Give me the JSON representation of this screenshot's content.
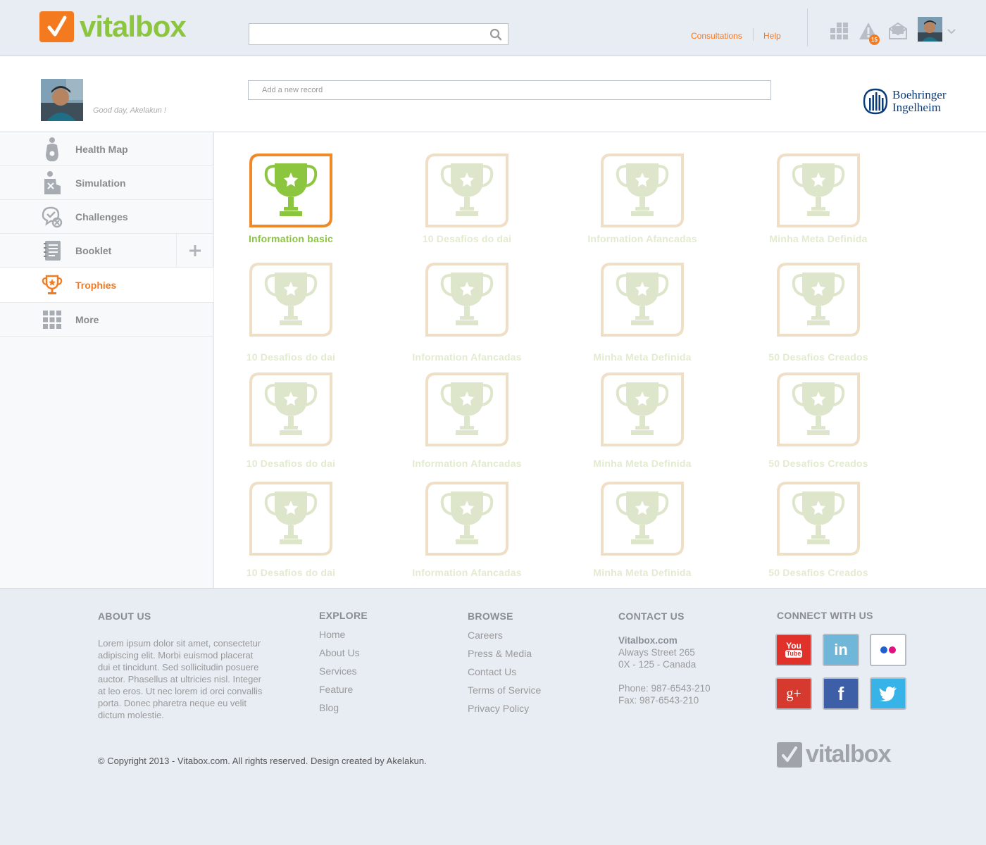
{
  "brand": {
    "name": "vitalbox",
    "accent": "#f47a20",
    "green": "#8cc63f"
  },
  "header": {
    "search_placeholder": "",
    "links": {
      "consultations": "Consultations",
      "help": "Help"
    },
    "notification_count": "15"
  },
  "profile": {
    "greeting": "Good day, Akelakun !",
    "add_record_placeholder": "Add a new record",
    "sponsor_line1": "Boehringer",
    "sponsor_line2": "Ingelheim"
  },
  "sidebar": {
    "items": [
      {
        "label": "Health Map",
        "icon": "body-map-icon"
      },
      {
        "label": "Simulation",
        "icon": "simulation-icon"
      },
      {
        "label": "Challenges",
        "icon": "challenges-icon"
      },
      {
        "label": "Booklet",
        "icon": "booklet-icon"
      },
      {
        "label": "Trophies",
        "icon": "trophy-icon",
        "active": true
      },
      {
        "label": "More",
        "icon": "grid-icon"
      }
    ]
  },
  "trophies": [
    {
      "label": "Information basic",
      "unlocked": true
    },
    {
      "label": "10 Desafios do dai",
      "unlocked": false
    },
    {
      "label": "Information Afancadas",
      "unlocked": false
    },
    {
      "label": "Minha Meta Definida",
      "unlocked": false
    },
    {
      "label": "10 Desafios do dai",
      "unlocked": false
    },
    {
      "label": "Information Afancadas",
      "unlocked": false
    },
    {
      "label": "Minha Meta Definida",
      "unlocked": false
    },
    {
      "label": "50 Desafios Creados",
      "unlocked": false
    },
    {
      "label": "10 Desafios do dai",
      "unlocked": false
    },
    {
      "label": "Information Afancadas",
      "unlocked": false
    },
    {
      "label": "Minha Meta Definida",
      "unlocked": false
    },
    {
      "label": "50 Desafios Creados",
      "unlocked": false
    },
    {
      "label": "10 Desafios do dai",
      "unlocked": false
    },
    {
      "label": "Information Afancadas",
      "unlocked": false
    },
    {
      "label": "Minha Meta Definida",
      "unlocked": false
    },
    {
      "label": "50 Desafios Creados",
      "unlocked": false
    }
  ],
  "footer": {
    "about": {
      "heading": "ABOUT US",
      "text": "Lorem ipsum dolor sit amet, consectetur adipiscing elit. Morbi euismod placerat dui et tincidunt. Sed sollicitudin posuere auctor. Phasellus at ultricies nisl. Integer at leo eros. Ut nec lorem id orci convallis porta. Donec pharetra neque eu velit dictum molestie."
    },
    "explore": {
      "heading": "EXPLORE",
      "links": [
        "Home",
        "About Us",
        "Services",
        "Feature",
        "Blog"
      ]
    },
    "browse": {
      "heading": "BROWSE",
      "links": [
        "Careers",
        "Press & Media",
        "Contact Us",
        "Terms of Service",
        "Privacy Policy"
      ]
    },
    "contact": {
      "heading": "CONTACT US",
      "company": "Vitalbox.com",
      "street": "Always Street 265",
      "city": "0X - 125 - Canada",
      "phone": "Phone: 987-6543-210",
      "fax": "Fax: 987-6543-210"
    },
    "connect": {
      "heading": "CONNECT WITH US",
      "networks": [
        {
          "name": "youtube-icon",
          "color": "#e0312b"
        },
        {
          "name": "linkedin-icon",
          "color": "#6fb6d8"
        },
        {
          "name": "flickr-icon",
          "color": "#ffffff"
        },
        {
          "name": "google-plus-icon",
          "color": "#d63a2f"
        },
        {
          "name": "facebook-icon",
          "color": "#3c5fa8"
        },
        {
          "name": "twitter-icon",
          "color": "#37b3e8"
        }
      ],
      "youtube_line1": "You",
      "youtube_line2": "Tube",
      "linkedin_text": "in",
      "google_text": "g+",
      "facebook_text": "f"
    },
    "copyright": "© Copyright 2013 - Vitabox.com. All rights reserved. Design created by Akelakun.",
    "logo_text": "vitalbox"
  }
}
